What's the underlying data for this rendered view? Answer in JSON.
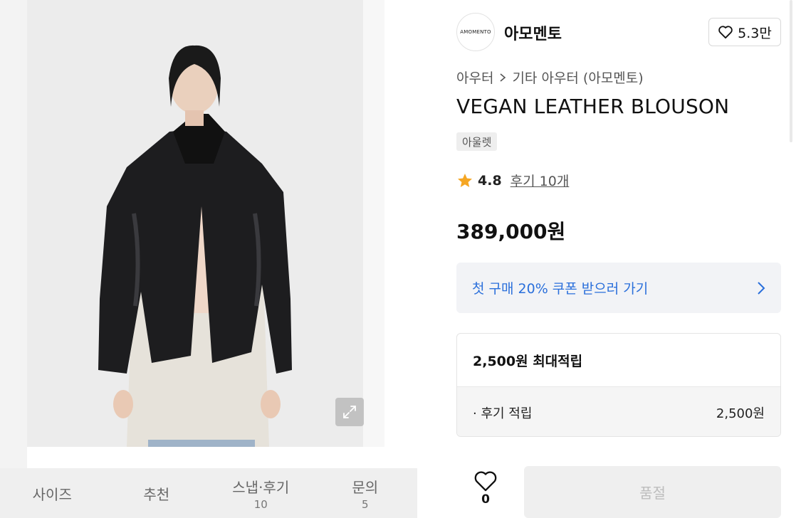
{
  "product_image": {
    "expand_icon": "expand-arrows-icon"
  },
  "tabs": [
    {
      "label": "사이즈",
      "count": ""
    },
    {
      "label": "추천",
      "count": ""
    },
    {
      "label": "스냅·후기",
      "count": "10"
    },
    {
      "label": "문의",
      "count": "5"
    }
  ],
  "brand": {
    "logo_text": "AMOMENTO",
    "name": "아모멘토",
    "likes": "5.3만"
  },
  "breadcrumb": {
    "level1": "아우터",
    "level2": "기타 아우터 (아모멘토)"
  },
  "product": {
    "title": "VEGAN LEATHER BLOUSON",
    "badge": "아울렛",
    "rating": "4.8",
    "reviews": "후기 10개",
    "price": "389,000원"
  },
  "coupon": {
    "label": "첫 구매 20% 쿠폰 받으러 가기"
  },
  "points": {
    "title": "2,500원 최대적립",
    "row_label": "· 후기 적립",
    "row_value": "2,500원"
  },
  "actions": {
    "wish_count": "0",
    "buy_label": "품절"
  },
  "colors": {
    "accent_blue": "#2a6fdb",
    "star": "#f5a623"
  }
}
